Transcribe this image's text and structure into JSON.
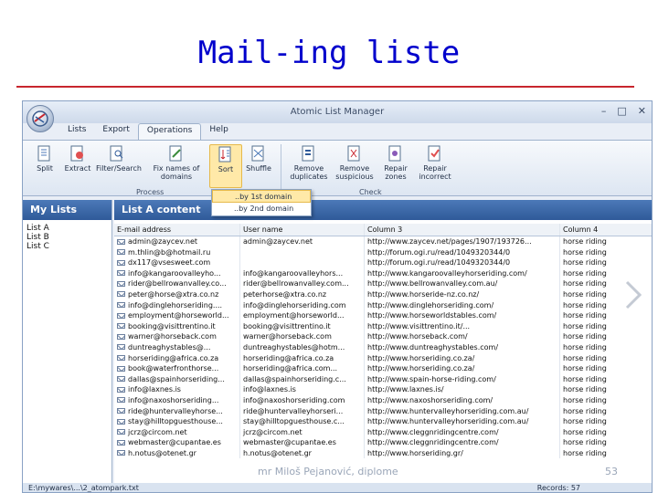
{
  "slide": {
    "title": "Mail-ing liste",
    "footer": "mr Miloš Pejanović, diplome",
    "page_number": "53"
  },
  "window": {
    "title": "Atomic List Manager",
    "controls": [
      "–",
      "□",
      "✕"
    ]
  },
  "menu": {
    "tabs": [
      "Lists",
      "Export",
      "Operations",
      "Help"
    ],
    "active": "Operations"
  },
  "ribbon": {
    "process_buttons": [
      {
        "label": "Split",
        "icon": "split-icon"
      },
      {
        "label": "Extract",
        "icon": "extract-icon"
      },
      {
        "label": "Filter/Search",
        "icon": "filter-icon"
      },
      {
        "label": "Fix names of domains",
        "icon": "fix-domains-icon"
      },
      {
        "label": "Sort",
        "icon": "sort-icon"
      },
      {
        "label": "Shuffle",
        "icon": "shuffle-icon"
      }
    ],
    "check_buttons": [
      {
        "label": "Remove duplicates",
        "icon": "remove-duplicates-icon"
      },
      {
        "label": "Remove suspicious",
        "icon": "remove-suspicious-icon"
      },
      {
        "label": "Repair zones",
        "icon": "repair-zones-icon"
      },
      {
        "label": "Repair incorrect",
        "icon": "repair-incorrect-icon"
      }
    ],
    "group_process": "Process",
    "group_check": "Check"
  },
  "sort_menu": {
    "items": [
      "..by 1st domain",
      "..by 2nd domain"
    ]
  },
  "sidebar": {
    "header": "My Lists",
    "items": [
      "List A",
      "List B",
      "List C"
    ]
  },
  "main": {
    "header": "List A content",
    "columns": [
      "E-mail address",
      "User name",
      "Column 3",
      "Column 4"
    ],
    "rows": [
      [
        "admin@zaycev.net",
        "admin@zaycev.net",
        "http://www.zaycev.net/pages/1907/193726...",
        "horse riding"
      ],
      [
        "m.thlin@b@hotmail.ru",
        "",
        "http://forum.ogi.ru/read/1049320344/0",
        "horse riding"
      ],
      [
        "dx117@vsesweet.com",
        "",
        "http://forum.ogi.ru/read/1049320344/0",
        "horse riding"
      ],
      [
        "info@kangaroovalleyho...",
        "info@kangaroovalleyhors...",
        "http://www.kangaroovalleyhorseriding.com/",
        "horse riding"
      ],
      [
        "rider@bellrowanvalley.co...",
        "rider@bellrowanvalley.com...",
        "http://www.bellrowanvalley.com.au/",
        "horse riding"
      ],
      [
        "peter@horse@xtra.co.nz",
        "peterhorse@xtra.co.nz",
        "http://www.horseride-nz.co.nz/",
        "horse riding"
      ],
      [
        "info@dinglehorseriding....",
        "info@dinglehorseriding.com",
        "http://www.dinglehorseriding.com/",
        "horse riding"
      ],
      [
        "employment@horseworld...",
        "employment@horseworld...",
        "http://www.horseworldstables.com/",
        "horse riding"
      ],
      [
        "booking@visittrentino.it",
        "booking@visittrentino.it",
        "http://www.visittrentino.it/...",
        "horse riding"
      ],
      [
        "warner@horseback.com",
        "warner@horseback.com",
        "http://www.horseback.com/",
        "horse riding"
      ],
      [
        "duntreaghystables@...",
        "duntreaghystables@hotm...",
        "http://www.duntreaghystables.com/",
        "horse riding"
      ],
      [
        "horseriding@africa.co.za",
        "horseriding@africa.co.za",
        "http://www.horseriding.co.za/",
        "horse riding"
      ],
      [
        "book@waterfronthorse...",
        "horseriding@africa.com...",
        "http://www.horseriding.co.za/",
        "horse riding"
      ],
      [
        "dallas@spainhorseriding...",
        "dallas@spainhorseriding.c...",
        "http://www.spain-horse-riding.com/",
        "horse riding"
      ],
      [
        "info@laxnes.is",
        "info@laxnes.is",
        "http://www.laxnes.is/",
        "horse riding"
      ],
      [
        "info@naxoshorseriding...",
        "info@naxoshorseriding.com",
        "http://www.naxoshorseriding.com/",
        "horse riding"
      ],
      [
        "ride@huntervalleyhorse...",
        "ride@huntervalleyhorseri...",
        "http://www.huntervalleyhorseriding.com.au/",
        "horse riding"
      ],
      [
        "stay@hilltopguesthouse...",
        "stay@hilltopguesthouse.c...",
        "http://www.huntervalleyhorseriding.com.au/",
        "horse riding"
      ],
      [
        "jcrz@circom.net",
        "jcrz@circom.net",
        "http://www.cleggnridingcentre.com/",
        "horse riding"
      ],
      [
        "webmaster@cupantae.es",
        "webmaster@cupantae.es",
        "http://www.cleggnridingcentre.com/",
        "horse riding"
      ],
      [
        "h.notus@otenet.gr",
        "h.notus@otenet.gr",
        "http://www.horseriding.gr/",
        "horse riding"
      ]
    ]
  },
  "statusbar": {
    "path": "E:\\mywares\\...\\2_atompark.txt",
    "count": "Records: 57"
  }
}
